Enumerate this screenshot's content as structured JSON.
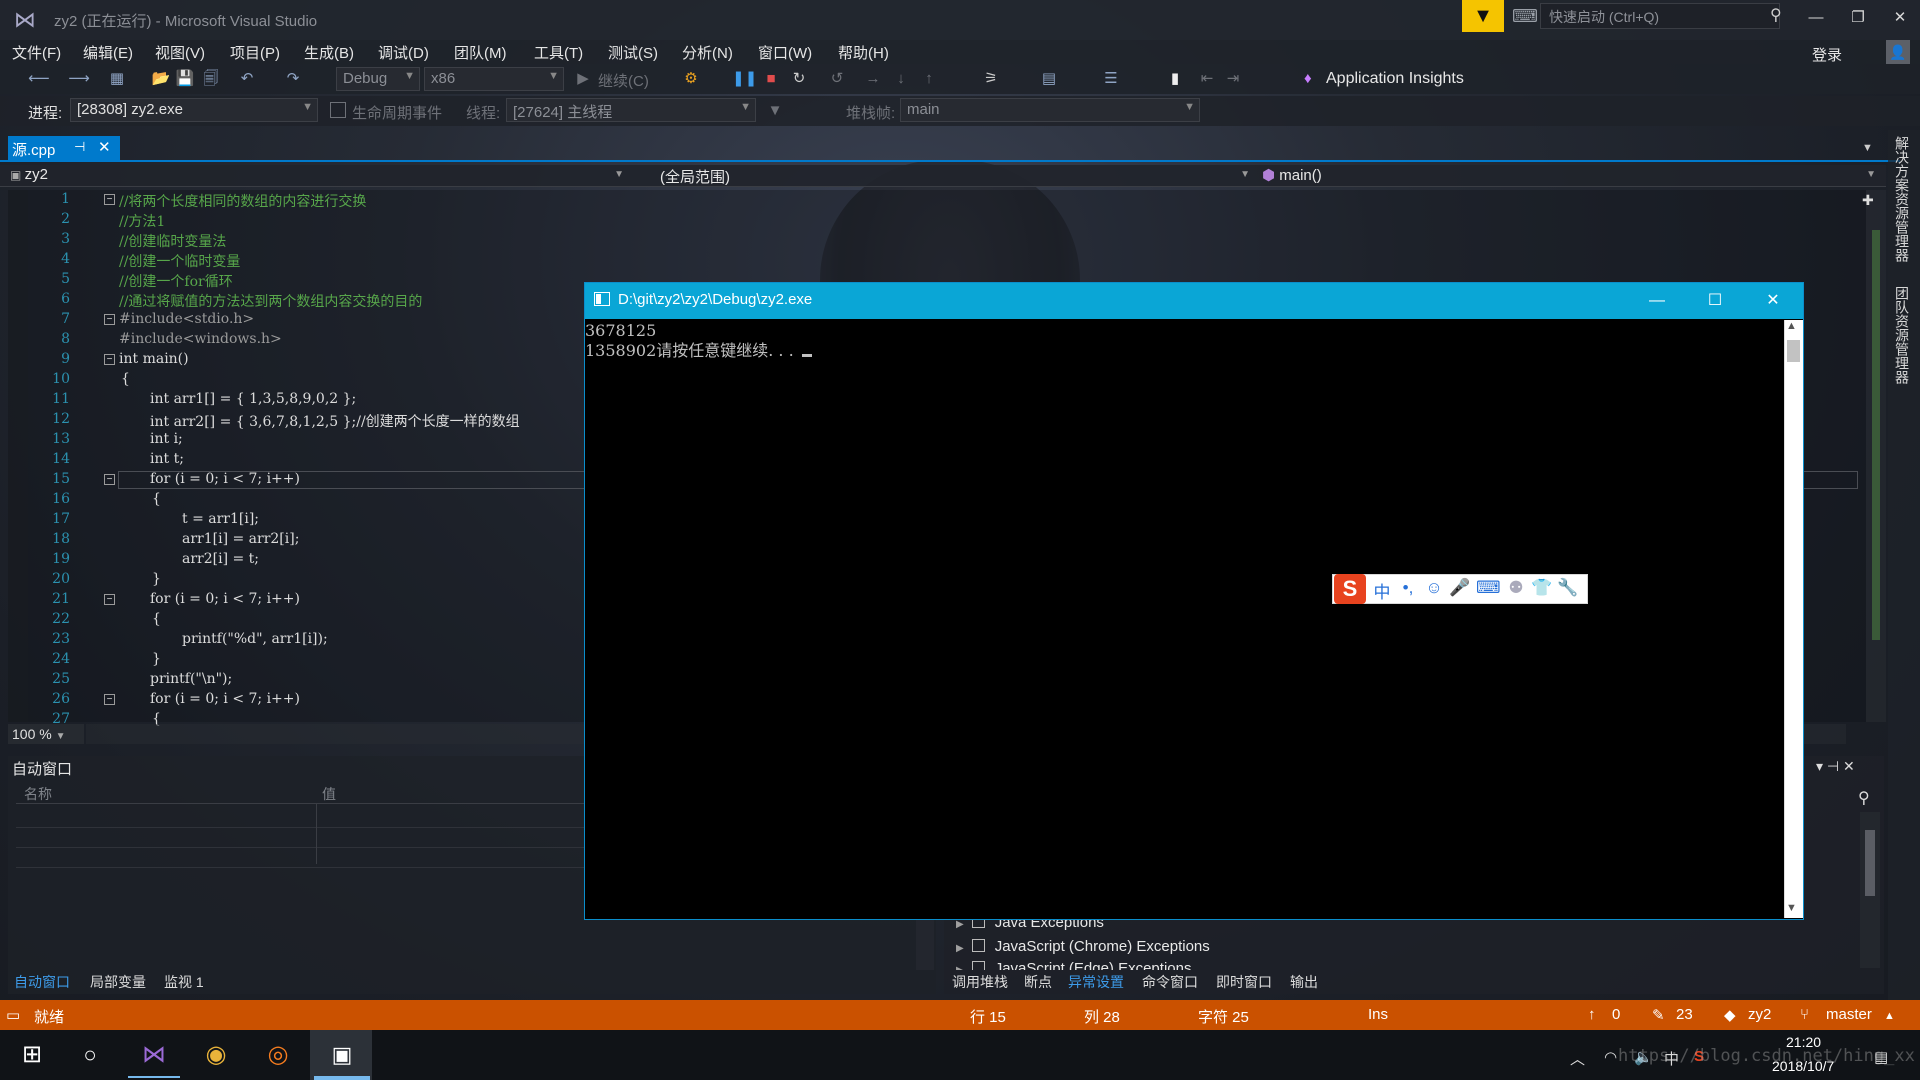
{
  "window": {
    "title": "zy2 (正在运行) - Microsoft Visual Studio",
    "quick_launch_placeholder": "快速启动 (Ctrl+Q)",
    "login_label": "登录"
  },
  "menu": [
    "文件(F)",
    "编辑(E)",
    "视图(V)",
    "项目(P)",
    "生成(B)",
    "调试(D)",
    "团队(M)",
    "工具(T)",
    "测试(S)",
    "分析(N)",
    "窗口(W)",
    "帮助(H)"
  ],
  "toolbar": {
    "config": "Debug",
    "platform": "x86",
    "continue_label": "继续(C)",
    "app_insights_label": "Application Insights"
  },
  "debugbar": {
    "process_label": "进程:",
    "process_value": "[28308] zy2.exe",
    "lifecycle_label": "生命周期事件",
    "thread_label": "线程:",
    "thread_value": "[27624] 主线程",
    "stack_label": "堆栈帧:",
    "stack_value": "main"
  },
  "tab": {
    "label": "源.cpp"
  },
  "nav": {
    "project": "zy2",
    "scope": "(全局范围)",
    "function": "main()"
  },
  "editor": {
    "zoom": "100 %",
    "line_numbers": [
      "1",
      "2",
      "3",
      "4",
      "5",
      "6",
      "7",
      "8",
      "9",
      "10",
      "11",
      "12",
      "13",
      "14",
      "15",
      "16",
      "17",
      "18",
      "19",
      "20",
      "21",
      "22",
      "23",
      "24",
      "25",
      "26",
      "27"
    ],
    "lines": [
      "//将两个长度相同的数组的内容进行交换",
      "//方法1",
      "//创建临时变量法",
      "//创建一个临时变量",
      "//创建一个for循环",
      "//通过将赋值的方法达到两个数组内容交换的目的",
      "#include<stdio.h>",
      "#include<windows.h>",
      "int main()",
      "{",
      "int arr1[] = { 1,3,5,8,9,0,2 };",
      "int arr2[] = { 3,6,7,8,1,2,5 };//创建两个长度一样的数组",
      "int i;",
      "int t;",
      "for (i = 0; i < 7; i++)",
      "{",
      "t = arr1[i];",
      "arr1[i] = arr2[i];",
      "arr2[i] = t;",
      "}",
      "for (i = 0; i < 7; i++)",
      "{",
      "printf(\"%d\", arr1[i]);",
      "}",
      "printf(\"\\n\");",
      "for (i = 0; i < 7; i++)",
      "{"
    ]
  },
  "side_tabs": [
    "解决方案资源管理器",
    "团队资源管理器"
  ],
  "auto_window": {
    "title": "自动窗口",
    "col_name": "名称",
    "col_value": "值",
    "tabs": [
      "自动窗口",
      "局部变量",
      "监视 1"
    ]
  },
  "exceptions": {
    "rows": [
      "Java Exceptions",
      "JavaScript (Chrome) Exceptions",
      "JavaScript (Edge) Exceptions"
    ],
    "tabs": [
      "调用堆栈",
      "断点",
      "异常设置",
      "命令窗口",
      "即时窗口",
      "输出"
    ]
  },
  "statusbar": {
    "ready": "就绪",
    "line": "行 15",
    "col": "列 28",
    "char": "字符 25",
    "ins": "Ins",
    "up_count": "0",
    "pencil_count": "23",
    "repo": "zy2",
    "branch": "master"
  },
  "console": {
    "path": "D:\\git\\zy2\\zy2\\Debug\\zy2.exe",
    "output_line1": "3678125",
    "output_line2": "1358902请按任意键继续. . ."
  },
  "taskbar": {
    "time": "21:20",
    "date": "2018/10/7",
    "ime_indicator": "中",
    "watermark": "https://blog.csdn.net/hing_xx"
  },
  "colors": {
    "status_bar": "#ca5100",
    "accent": "#007acc",
    "console_title": "#0aa6d6"
  }
}
